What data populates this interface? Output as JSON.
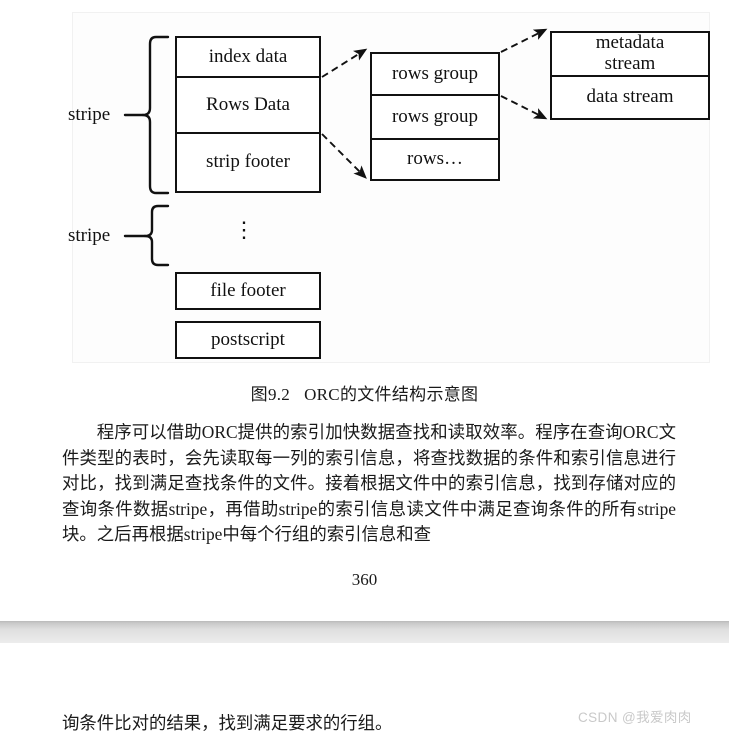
{
  "figure": {
    "caption_number": "图9.2",
    "caption_text": "ORC的文件结构示意图",
    "stripe_label_1": "stripe",
    "stripe_label_2": "stripe",
    "ellipsis_vertical": "⋮",
    "stripe_box": {
      "rows": [
        {
          "label": "index data"
        },
        {
          "label": "Rows Data"
        },
        {
          "label": "strip footer"
        }
      ]
    },
    "rows_group_box": {
      "rows": [
        {
          "label": "rows group"
        },
        {
          "label": "rows group"
        },
        {
          "label": "rows…"
        }
      ]
    },
    "stream_box": {
      "rows": [
        {
          "label": "metadata\nstream",
          "line1": "metadata",
          "line2": "stream"
        },
        {
          "label": "data stream"
        }
      ]
    },
    "footer_boxes": [
      {
        "label": "file footer"
      },
      {
        "label": "postscript"
      }
    ]
  },
  "page": {
    "body_paragraph": "程序可以借助ORC提供的索引加快数据查找和读取效率。程序在查询ORC文件类型的表时，会先读取每一列的索引信息，将查找数据的条件和索引信息进行对比，找到满足查找条件的文件。接着根据文件中的索引信息，找到存储对应的查询条件数据stripe，再借助stripe的索引信息读文件中满足查询条件的所有stripe块。之后再根据stripe中每个行组的索引信息和查",
    "page_number": "360",
    "body_paragraph_continued": "询条件比对的结果，找到满足要求的行组。"
  },
  "watermark": {
    "text": "CSDN @我爱肉肉"
  },
  "colors": {
    "ink": "#111111",
    "text": "#1a1a1a",
    "panel_bg": "#fdfdfd",
    "panel_border": "#f1f1f1",
    "watermark": "#c9c9c9",
    "page_break_top": "#b9b9b9",
    "page_break_bottom": "#ececec"
  }
}
